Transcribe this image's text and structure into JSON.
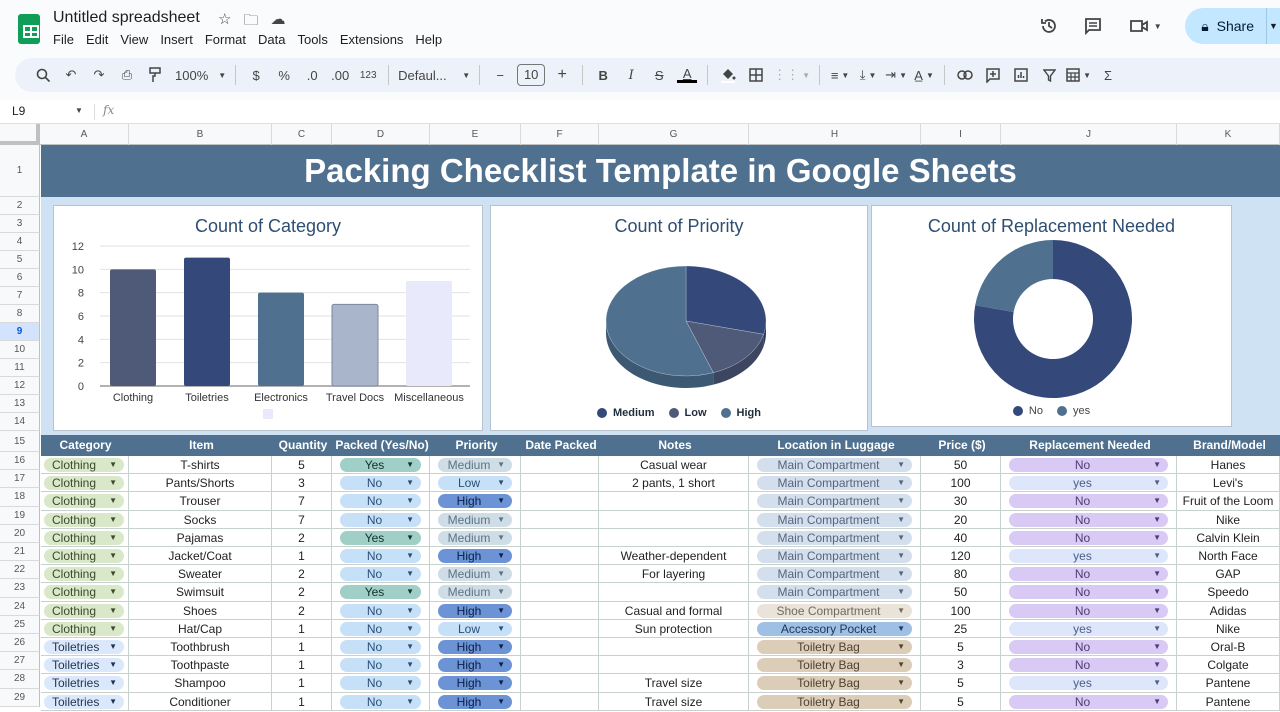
{
  "app": {
    "doc_title": "Untitled spreadsheet",
    "menu": [
      "File",
      "Edit",
      "View",
      "Insert",
      "Format",
      "Data",
      "Tools",
      "Extensions",
      "Help"
    ],
    "share_label": "Share",
    "title_icons": [
      "star-icon",
      "move-to-folder-icon",
      "cloud-status-icon"
    ],
    "right_icons": [
      "version-history-icon",
      "comments-icon",
      "meet-icon"
    ]
  },
  "toolbar": {
    "zoom": "100%",
    "currency": "$",
    "percent": "%",
    "decrease_decimal": ".0",
    "increase_decimal": ".00",
    "number_format": "123",
    "font": "Defaul...",
    "font_size": "10",
    "minus": "−",
    "plus": "+",
    "bold": "B",
    "italic": "I",
    "strike": "S",
    "text_color": "A",
    "sigma": "Σ"
  },
  "formula_bar": {
    "cell_ref": "L9",
    "fx": "fx",
    "value": ""
  },
  "columns": [
    "A",
    "B",
    "C",
    "D",
    "E",
    "F",
    "G",
    "H",
    "I",
    "J",
    "K"
  ],
  "rows": [
    "1",
    "2",
    "3",
    "4",
    "5",
    "6",
    "7",
    "8",
    "9",
    "10",
    "11",
    "12",
    "13",
    "14",
    "15",
    "16",
    "17",
    "18",
    "19",
    "20",
    "21",
    "22",
    "23",
    "24",
    "25",
    "26",
    "27",
    "28",
    "29"
  ],
  "selected_row": "9",
  "banner_title": "Packing Checklist Template in Google Sheets",
  "chart_data": [
    {
      "type": "bar",
      "title": "Count of Category",
      "categories": [
        "Clothing",
        "Toiletries",
        "Electronics",
        "Travel Docs",
        "Miscellaneous"
      ],
      "values": [
        10,
        11,
        8,
        7,
        9
      ],
      "colors": [
        "#4e5a78",
        "#34497a",
        "#4f718f",
        "#a9b5cb",
        "#e8eafc"
      ],
      "ylim": [
        0,
        12
      ],
      "yticks": [
        0,
        2,
        4,
        6,
        8,
        10,
        12
      ],
      "grid": true,
      "xlabel": "",
      "ylabel": "",
      "legend": "bottom"
    },
    {
      "type": "pie",
      "title": "Count of Priority",
      "labels": [
        "Medium",
        "Low",
        "High"
      ],
      "values": [
        13,
        7,
        25
      ],
      "colors": [
        "#34497a",
        "#4e5a78",
        "#4f718f"
      ],
      "style": "3d",
      "legend": "bottom"
    },
    {
      "type": "pie",
      "title": "Count of Replacement Needed",
      "labels": [
        "No",
        "yes"
      ],
      "values": [
        35,
        10
      ],
      "colors": [
        "#34497a",
        "#4f718f"
      ],
      "style": "donut",
      "legend": "bottom"
    }
  ],
  "table": {
    "headers": [
      "Category",
      "Item",
      "Quantity",
      "Packed (Yes/No)",
      "Priority",
      "Date Packed",
      "Notes",
      "Location in Luggage",
      "Price ($)",
      "Replacement Needed",
      "Brand/Model"
    ],
    "rows": [
      [
        "Clothing",
        "T-shirts",
        "5",
        "Yes",
        "Medium",
        "",
        "Casual wear",
        "Main Compartment",
        "50",
        "No",
        "Hanes"
      ],
      [
        "Clothing",
        "Pants/Shorts",
        "3",
        "No",
        "Low",
        "",
        "2 pants, 1 short",
        "Main Compartment",
        "100",
        "yes",
        "Levi's"
      ],
      [
        "Clothing",
        "Trouser",
        "7",
        "No",
        "High",
        "",
        "",
        "Main Compartment",
        "30",
        "No",
        "Fruit of the Loom"
      ],
      [
        "Clothing",
        "Socks",
        "7",
        "No",
        "Medium",
        "",
        "",
        "Main Compartment",
        "20",
        "No",
        "Nike"
      ],
      [
        "Clothing",
        "Pajamas",
        "2",
        "Yes",
        "Medium",
        "",
        "",
        "Main Compartment",
        "40",
        "No",
        "Calvin Klein"
      ],
      [
        "Clothing",
        "Jacket/Coat",
        "1",
        "No",
        "High",
        "",
        "Weather-dependent",
        "Main Compartment",
        "120",
        "yes",
        "North Face"
      ],
      [
        "Clothing",
        "Sweater",
        "2",
        "No",
        "Medium",
        "",
        "For layering",
        "Main Compartment",
        "80",
        "No",
        "GAP"
      ],
      [
        "Clothing",
        "Swimsuit",
        "2",
        "Yes",
        "Medium",
        "",
        "",
        "Main Compartment",
        "50",
        "No",
        "Speedo"
      ],
      [
        "Clothing",
        "Shoes",
        "2",
        "No",
        "High",
        "",
        "Casual and formal",
        "Shoe Compartment",
        "100",
        "No",
        "Adidas"
      ],
      [
        "Clothing",
        "Hat/Cap",
        "1",
        "No",
        "Low",
        "",
        "Sun protection",
        "Accessory Pocket",
        "25",
        "yes",
        "Nike"
      ],
      [
        "Toiletries",
        "Toothbrush",
        "1",
        "No",
        "High",
        "",
        "",
        "Toiletry Bag",
        "5",
        "No",
        "Oral-B"
      ],
      [
        "Toiletries",
        "Toothpaste",
        "1",
        "No",
        "High",
        "",
        "",
        "Toiletry Bag",
        "3",
        "No",
        "Colgate"
      ],
      [
        "Toiletries",
        "Shampoo",
        "1",
        "No",
        "High",
        "",
        "Travel size",
        "Toiletry Bag",
        "5",
        "yes",
        "Pantene"
      ],
      [
        "Toiletries",
        "Conditioner",
        "1",
        "No",
        "High",
        "",
        "Travel size",
        "Toiletry Bag",
        "5",
        "No",
        "Pantene"
      ]
    ]
  },
  "chip_colors": {
    "Clothing": {
      "bg": "#d9e8c8",
      "fg": "#3b4a2e"
    },
    "Toiletries": {
      "bg": "#dbe8fb",
      "fg": "#1f3350"
    },
    "Yes": {
      "bg": "#9fcfc6",
      "fg": "#11302b"
    },
    "No": {
      "bg": "#c6e0f7",
      "fg": "#2b4f7a"
    },
    "Medium": {
      "bg": "#cfdde6",
      "fg": "#5c7485"
    },
    "Low": {
      "bg": "#c6e0f7",
      "fg": "#2b4f7a"
    },
    "High": {
      "bg": "#6b93d6",
      "fg": "#0c1f45"
    },
    "Main Compartment": {
      "bg": "#d4dfee",
      "fg": "#55657a"
    },
    "Shoe Compartment": {
      "bg": "#e9e3d9",
      "fg": "#6f6a62"
    },
    "Accessory Pocket": {
      "bg": "#9ec0e4",
      "fg": "#20385a"
    },
    "Toiletry Bag": {
      "bg": "#dccdb8",
      "fg": "#4e4232"
    },
    "No_repl": {
      "bg": "#d8c9f5",
      "fg": "#4d3d75"
    },
    "yes_repl": {
      "bg": "#dde6fa",
      "fg": "#4d5f85"
    }
  },
  "colors": {
    "header_blue": "#4f718f",
    "dashboard_bg": "#cfe2f3",
    "share_bg": "#c2e7ff",
    "toolbar_bg": "#edf2fa"
  }
}
